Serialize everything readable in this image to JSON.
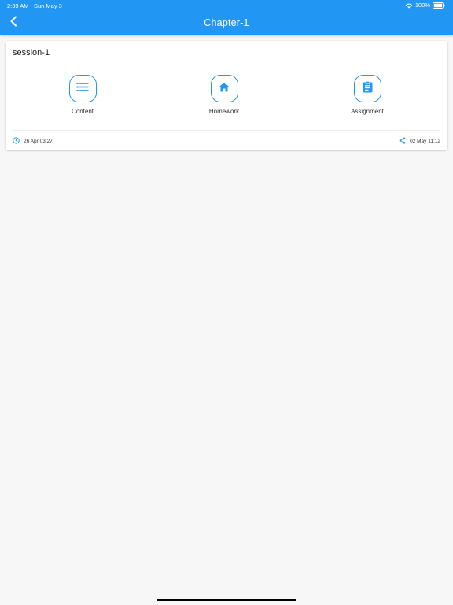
{
  "status_bar": {
    "time": "2:39 AM",
    "date": "Sun May 3",
    "battery": "100%",
    "icons": [
      "wifi-icon",
      "battery-icon"
    ]
  },
  "header": {
    "title": "Chapter-1",
    "back_icon": "chevron-left-icon"
  },
  "session": {
    "title": "session-1",
    "actions": [
      {
        "label": "Content",
        "icon": "list-icon"
      },
      {
        "label": "Homework",
        "icon": "home-icon"
      },
      {
        "label": "Assignment",
        "icon": "clipboard-icon"
      }
    ],
    "created": "26 Apr 03:27",
    "shared": "02 May 11:12"
  },
  "colors": {
    "accent": "#2196f3",
    "background": "#f7f7f7",
    "card": "#ffffff"
  }
}
